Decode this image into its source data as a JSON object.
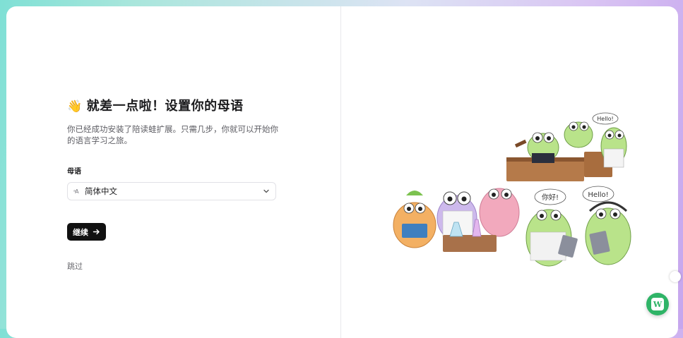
{
  "onboarding": {
    "wave_emoji": "👋",
    "title": "就差一点啦！设置你的母语",
    "subtitle": "你已经成功安装了陪读蛙扩展。只需几步，你就可以开始你的语言学习之旅。",
    "field_label": "母语",
    "language_select": {
      "icon": "language-icon",
      "value": "简体中文"
    },
    "continue_label": "继续",
    "skip_label": "跳过"
  },
  "illustration": {
    "bubbles": [
      "Hello!",
      "你好!",
      "Hello!"
    ]
  },
  "fab_label": "W",
  "colors": {
    "button_bg": "#111111",
    "fab_bg": "#2fb467",
    "frog_green": "#b9e38a"
  }
}
